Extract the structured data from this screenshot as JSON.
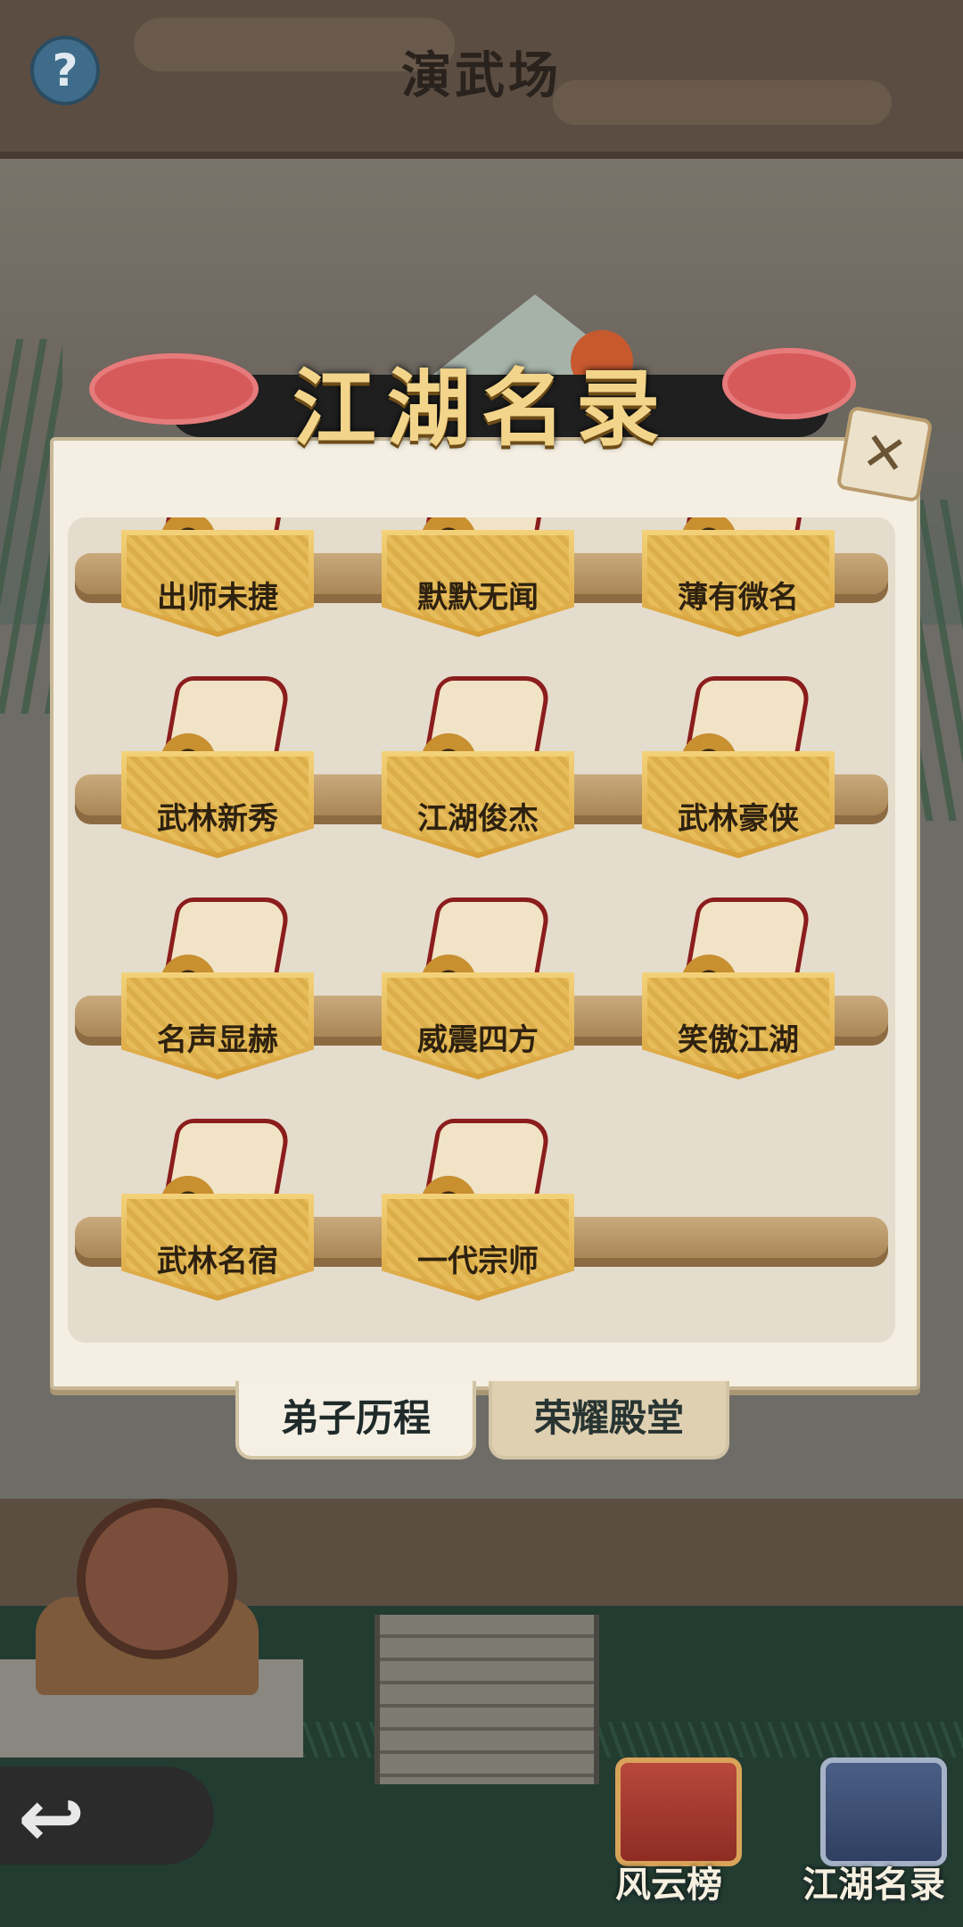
{
  "header": {
    "title": "演武场",
    "help_icon": "?"
  },
  "dialog": {
    "banner_title": "江湖名录",
    "close_icon": "✕",
    "awards": [
      "出师未捷",
      "默默无闻",
      "薄有微名",
      "武林新秀",
      "江湖俊杰",
      "武林豪侠",
      "名声显赫",
      "威震四方",
      "笑傲江湖",
      "武林名宿",
      "一代宗师"
    ],
    "tabs": [
      {
        "label": "弟子历程",
        "selected": true
      },
      {
        "label": "荣耀殿堂",
        "selected": false
      }
    ]
  },
  "bottom": {
    "back_icon": "↩",
    "buttons": [
      {
        "label": "风云榜",
        "icon": "ranking-scroll-icon"
      },
      {
        "label": "江湖名录",
        "icon": "book-icon"
      }
    ]
  }
}
